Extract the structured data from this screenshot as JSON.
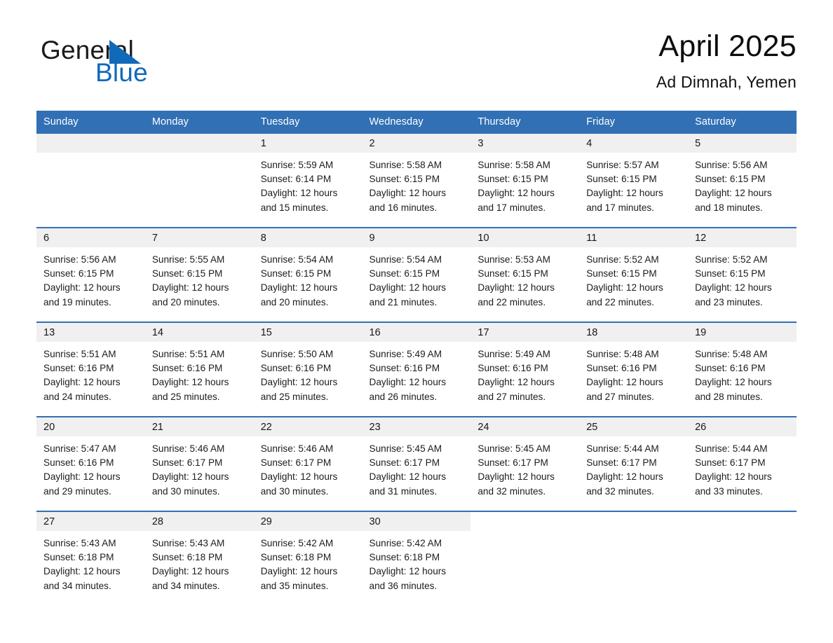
{
  "brand": {
    "name_top": "General",
    "name_bottom": "Blue",
    "triangle_color": "#1169ba",
    "text_color": "#1b1b1b"
  },
  "header": {
    "title": "April 2025",
    "subtitle": "Ad Dimnah, Yemen"
  },
  "theme": {
    "accent": "#3170b4",
    "header_text": "#ffffff",
    "daynum_band": "#f0f0f0",
    "body_text": "#1c1c1c",
    "page_background": "#ffffff"
  },
  "calendar": {
    "month": "April",
    "year": "2025",
    "location": "Ad Dimnah, Yemen",
    "weekday_headers": [
      "Sunday",
      "Monday",
      "Tuesday",
      "Wednesday",
      "Thursday",
      "Friday",
      "Saturday"
    ],
    "weeks": [
      [
        {
          "day": "",
          "lines": []
        },
        {
          "day": "",
          "lines": []
        },
        {
          "day": "1",
          "lines": [
            "Sunrise: 5:59 AM",
            "Sunset: 6:14 PM",
            "Daylight: 12 hours",
            "and 15 minutes."
          ]
        },
        {
          "day": "2",
          "lines": [
            "Sunrise: 5:58 AM",
            "Sunset: 6:15 PM",
            "Daylight: 12 hours",
            "and 16 minutes."
          ]
        },
        {
          "day": "3",
          "lines": [
            "Sunrise: 5:58 AM",
            "Sunset: 6:15 PM",
            "Daylight: 12 hours",
            "and 17 minutes."
          ]
        },
        {
          "day": "4",
          "lines": [
            "Sunrise: 5:57 AM",
            "Sunset: 6:15 PM",
            "Daylight: 12 hours",
            "and 17 minutes."
          ]
        },
        {
          "day": "5",
          "lines": [
            "Sunrise: 5:56 AM",
            "Sunset: 6:15 PM",
            "Daylight: 12 hours",
            "and 18 minutes."
          ]
        }
      ],
      [
        {
          "day": "6",
          "lines": [
            "Sunrise: 5:56 AM",
            "Sunset: 6:15 PM",
            "Daylight: 12 hours",
            "and 19 minutes."
          ]
        },
        {
          "day": "7",
          "lines": [
            "Sunrise: 5:55 AM",
            "Sunset: 6:15 PM",
            "Daylight: 12 hours",
            "and 20 minutes."
          ]
        },
        {
          "day": "8",
          "lines": [
            "Sunrise: 5:54 AM",
            "Sunset: 6:15 PM",
            "Daylight: 12 hours",
            "and 20 minutes."
          ]
        },
        {
          "day": "9",
          "lines": [
            "Sunrise: 5:54 AM",
            "Sunset: 6:15 PM",
            "Daylight: 12 hours",
            "and 21 minutes."
          ]
        },
        {
          "day": "10",
          "lines": [
            "Sunrise: 5:53 AM",
            "Sunset: 6:15 PM",
            "Daylight: 12 hours",
            "and 22 minutes."
          ]
        },
        {
          "day": "11",
          "lines": [
            "Sunrise: 5:52 AM",
            "Sunset: 6:15 PM",
            "Daylight: 12 hours",
            "and 22 minutes."
          ]
        },
        {
          "day": "12",
          "lines": [
            "Sunrise: 5:52 AM",
            "Sunset: 6:15 PM",
            "Daylight: 12 hours",
            "and 23 minutes."
          ]
        }
      ],
      [
        {
          "day": "13",
          "lines": [
            "Sunrise: 5:51 AM",
            "Sunset: 6:16 PM",
            "Daylight: 12 hours",
            "and 24 minutes."
          ]
        },
        {
          "day": "14",
          "lines": [
            "Sunrise: 5:51 AM",
            "Sunset: 6:16 PM",
            "Daylight: 12 hours",
            "and 25 minutes."
          ]
        },
        {
          "day": "15",
          "lines": [
            "Sunrise: 5:50 AM",
            "Sunset: 6:16 PM",
            "Daylight: 12 hours",
            "and 25 minutes."
          ]
        },
        {
          "day": "16",
          "lines": [
            "Sunrise: 5:49 AM",
            "Sunset: 6:16 PM",
            "Daylight: 12 hours",
            "and 26 minutes."
          ]
        },
        {
          "day": "17",
          "lines": [
            "Sunrise: 5:49 AM",
            "Sunset: 6:16 PM",
            "Daylight: 12 hours",
            "and 27 minutes."
          ]
        },
        {
          "day": "18",
          "lines": [
            "Sunrise: 5:48 AM",
            "Sunset: 6:16 PM",
            "Daylight: 12 hours",
            "and 27 minutes."
          ]
        },
        {
          "day": "19",
          "lines": [
            "Sunrise: 5:48 AM",
            "Sunset: 6:16 PM",
            "Daylight: 12 hours",
            "and 28 minutes."
          ]
        }
      ],
      [
        {
          "day": "20",
          "lines": [
            "Sunrise: 5:47 AM",
            "Sunset: 6:16 PM",
            "Daylight: 12 hours",
            "and 29 minutes."
          ]
        },
        {
          "day": "21",
          "lines": [
            "Sunrise: 5:46 AM",
            "Sunset: 6:17 PM",
            "Daylight: 12 hours",
            "and 30 minutes."
          ]
        },
        {
          "day": "22",
          "lines": [
            "Sunrise: 5:46 AM",
            "Sunset: 6:17 PM",
            "Daylight: 12 hours",
            "and 30 minutes."
          ]
        },
        {
          "day": "23",
          "lines": [
            "Sunrise: 5:45 AM",
            "Sunset: 6:17 PM",
            "Daylight: 12 hours",
            "and 31 minutes."
          ]
        },
        {
          "day": "24",
          "lines": [
            "Sunrise: 5:45 AM",
            "Sunset: 6:17 PM",
            "Daylight: 12 hours",
            "and 32 minutes."
          ]
        },
        {
          "day": "25",
          "lines": [
            "Sunrise: 5:44 AM",
            "Sunset: 6:17 PM",
            "Daylight: 12 hours",
            "and 32 minutes."
          ]
        },
        {
          "day": "26",
          "lines": [
            "Sunrise: 5:44 AM",
            "Sunset: 6:17 PM",
            "Daylight: 12 hours",
            "and 33 minutes."
          ]
        }
      ],
      [
        {
          "day": "27",
          "lines": [
            "Sunrise: 5:43 AM",
            "Sunset: 6:18 PM",
            "Daylight: 12 hours",
            "and 34 minutes."
          ]
        },
        {
          "day": "28",
          "lines": [
            "Sunrise: 5:43 AM",
            "Sunset: 6:18 PM",
            "Daylight: 12 hours",
            "and 34 minutes."
          ]
        },
        {
          "day": "29",
          "lines": [
            "Sunrise: 5:42 AM",
            "Sunset: 6:18 PM",
            "Daylight: 12 hours",
            "and 35 minutes."
          ]
        },
        {
          "day": "30",
          "lines": [
            "Sunrise: 5:42 AM",
            "Sunset: 6:18 PM",
            "Daylight: 12 hours",
            "and 36 minutes."
          ]
        },
        {
          "day": "",
          "lines": []
        },
        {
          "day": "",
          "lines": []
        },
        {
          "day": "",
          "lines": []
        }
      ]
    ]
  }
}
